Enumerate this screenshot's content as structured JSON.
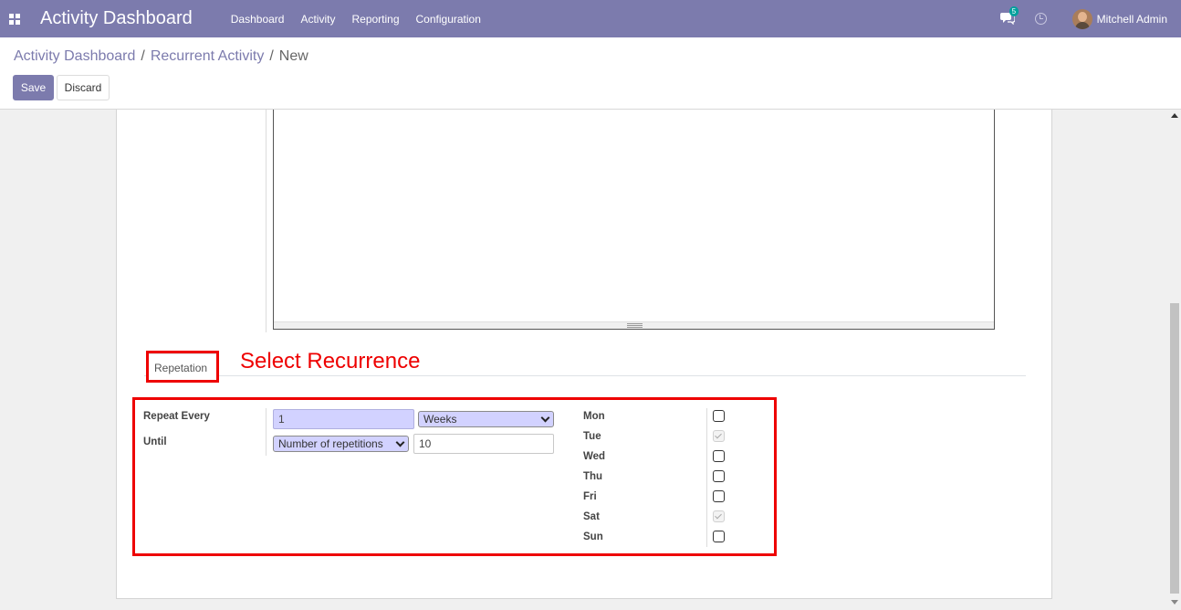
{
  "navbar": {
    "app_title": "Activity Dashboard",
    "menu": [
      "Dashboard",
      "Activity",
      "Reporting",
      "Configuration"
    ],
    "messages_count": "5",
    "user_name": "Mitchell Admin",
    "bg_color": "#7c7bad"
  },
  "breadcrumb": {
    "items": [
      "Activity Dashboard",
      "Recurrent Activity"
    ],
    "separator": "/",
    "current": "New"
  },
  "buttons": {
    "save": "Save",
    "discard": "Discard"
  },
  "tabs": {
    "repetation": "Repetation"
  },
  "annotation": {
    "text": "Select Recurrence",
    "color": "#ee0000"
  },
  "form": {
    "repeat_every_label": "Repeat Every",
    "repeat_every_value": "1",
    "repeat_unit": "Weeks",
    "until_label": "Until",
    "until_type": "Number of repetitions",
    "until_count": "10",
    "days": [
      {
        "label": "Mon",
        "checked": false
      },
      {
        "label": "Tue",
        "checked": true
      },
      {
        "label": "Wed",
        "checked": false
      },
      {
        "label": "Thu",
        "checked": false
      },
      {
        "label": "Fri",
        "checked": false
      },
      {
        "label": "Sat",
        "checked": true
      },
      {
        "label": "Sun",
        "checked": false
      }
    ]
  }
}
